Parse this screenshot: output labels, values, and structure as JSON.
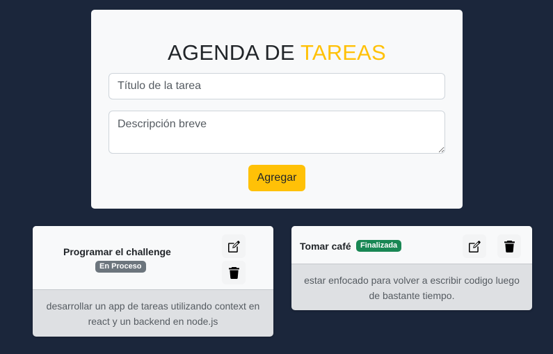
{
  "header": {
    "title_main": "AGENDA DE",
    "title_accent": "TAREAS"
  },
  "form": {
    "title_placeholder": "Título de la tarea",
    "description_placeholder": "Descripción breve",
    "submit_label": "Agregar"
  },
  "tasks": [
    {
      "name": "Programar el challenge",
      "status": "En Proceso",
      "status_color": "#6c757d",
      "description": "desarrollar un app de tareas utilizando context en react y un backend en node.js",
      "edit_icon": "edit-icon",
      "delete_icon": "trash-icon"
    },
    {
      "name": "Tomar café",
      "status": "Finalizada",
      "status_color": "#198754",
      "description": "estar enfocado para volver a escribir codigo luego de bastante tiempo.",
      "edit_icon": "edit-icon",
      "delete_icon": "trash-icon"
    }
  ],
  "colors": {
    "background": "#1b263b",
    "accent": "#ffc107"
  }
}
